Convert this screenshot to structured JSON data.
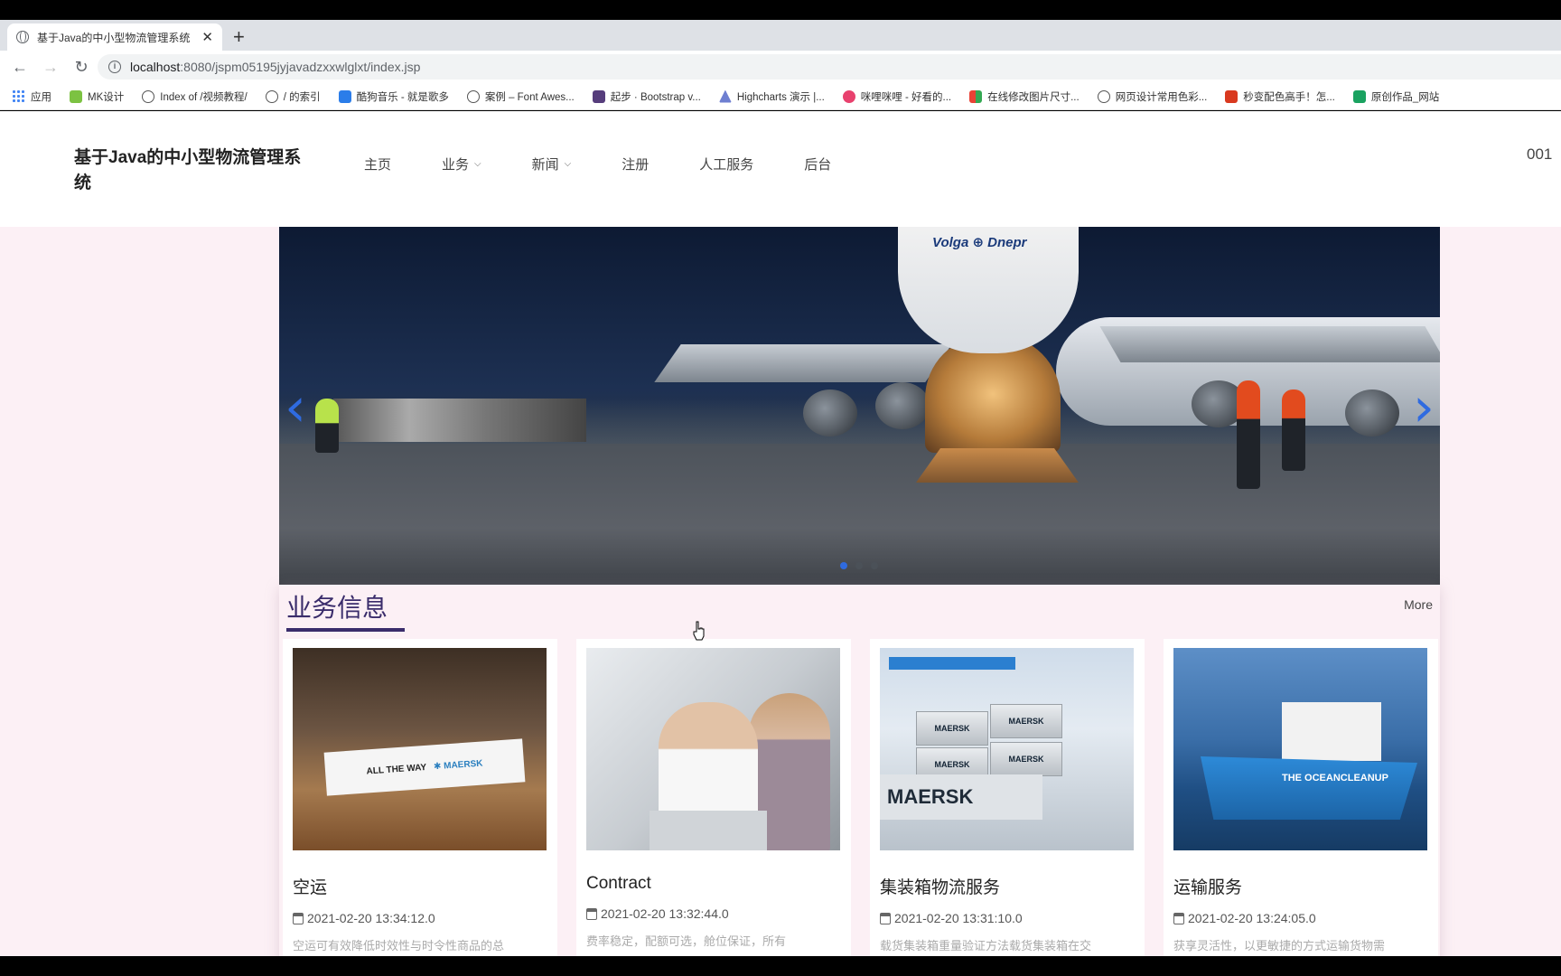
{
  "browser": {
    "tab_title": "基于Java的中小型物流管理系统",
    "url_host": "localhost",
    "url_rest": ":8080/jspm05195jyjavadzxxwlglxt/index.jsp",
    "bookmarks": [
      "应用",
      "MK设计",
      "Index of /视频教程/",
      "/ 的索引",
      "酷狗音乐 - 就是歌多",
      "案例 – Font Awes...",
      "起步 · Bootstrap v...",
      "Highcharts 演示 |...",
      "咪哩咪哩 - 好看的...",
      "在线修改图片尺寸...",
      "网页设计常用色彩...",
      "秒变配色高手！怎...",
      "原创作品_网站"
    ]
  },
  "site": {
    "brand": "基于Java的中小型物流管理系统",
    "nav": [
      "主页",
      "业务",
      "新闻",
      "注册",
      "人工服务",
      "后台"
    ],
    "user": "001"
  },
  "carousel": {
    "plane_text": "Volga ⊕ Dnepr",
    "slides": 3,
    "active_slide": 1
  },
  "section": {
    "title": "业务信息",
    "more": "More",
    "cards": [
      {
        "title": "空运",
        "date": "2021-02-20 13:34:12.0",
        "desc": "空运可有效降低时效性与时令性商品的总"
      },
      {
        "title": "Contract",
        "date": "2021-02-20 13:32:44.0",
        "desc": "费率稳定，配额可选，舱位保证，所有"
      },
      {
        "title": "集装箱物流服务",
        "date": "2021-02-20 13:31:10.0",
        "desc": "载货集装箱重量验证方法载货集装箱在交"
      },
      {
        "title": "运输服务",
        "date": "2021-02-20 13:24:05.0",
        "desc": "获享灵活性，以更敏捷的方式运输货物需"
      }
    ]
  },
  "image_text": {
    "t1_banner": "ALL THE WAY",
    "t1_brand": "✱ MAERSK",
    "t3_box": "MAERSK",
    "t3_big": "MAERSK",
    "t4_label": "THE OCEANCLEANUP"
  },
  "colors": {
    "accent": "#3a2c6b",
    "carousel_arrow": "#2f6be0",
    "page_bg": "#fcf0f5"
  }
}
